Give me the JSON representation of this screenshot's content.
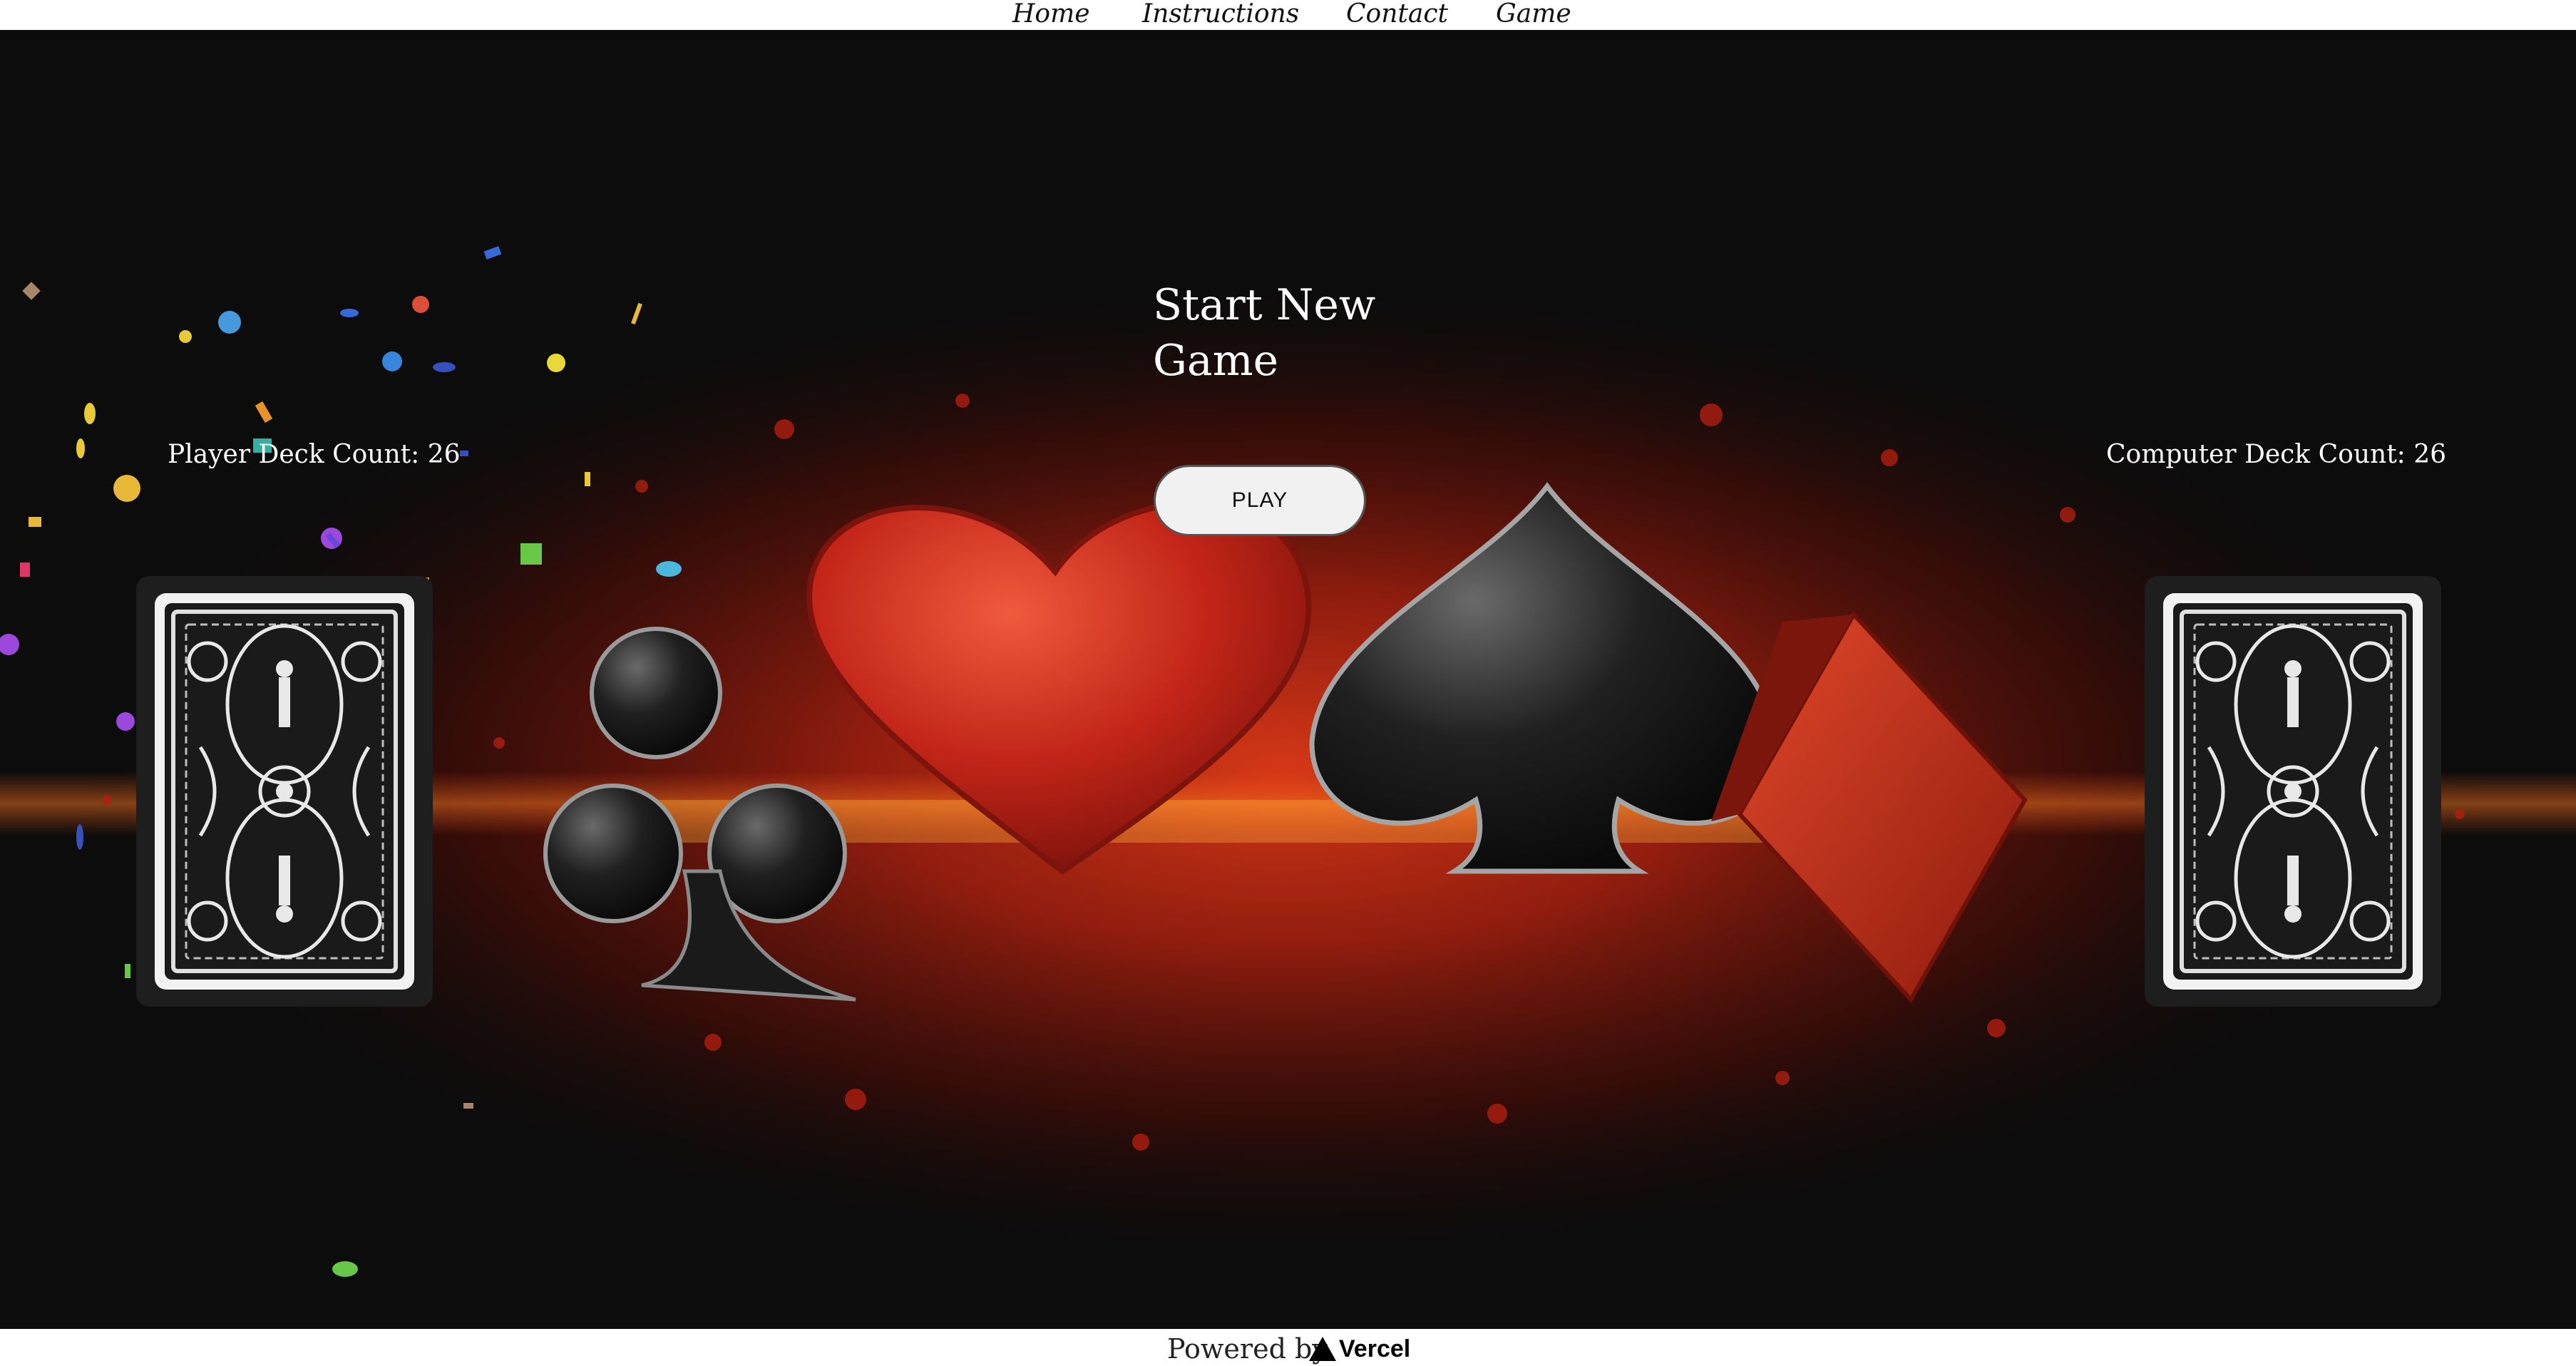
{
  "nav": {
    "home": "Home",
    "instructions": "Instructions",
    "contact": "Contact",
    "game": "Game"
  },
  "game": {
    "title": "Start New Game",
    "play_label": "PLAY",
    "player_deck_count": "Player Deck Count: 26",
    "computer_deck_count": "Computer Deck Count: 26"
  },
  "footer": {
    "powered_by": "Powered by",
    "brand": "Vercel"
  },
  "icons": {
    "card_suits": [
      "club-icon",
      "heart-icon",
      "spade-icon",
      "diamond-icon"
    ],
    "card_back": "card-back-icon",
    "vercel": "vercel-triangle-icon"
  },
  "colors": {
    "stage_background": "#0c0c0c",
    "glow_red": "#c42a14",
    "heart_red": "#c8281a",
    "spade_black": "#1a1a1a",
    "nav_background": "#ffffff",
    "button_background": "#f1f1f1"
  }
}
